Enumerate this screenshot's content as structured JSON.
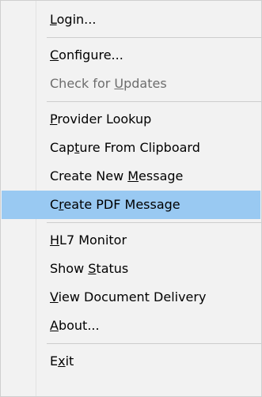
{
  "menu": {
    "groups": [
      {
        "items": [
          {
            "pre": "",
            "acc": "L",
            "post": "ogin...",
            "disabled": false,
            "highlighted": false
          }
        ]
      },
      {
        "items": [
          {
            "pre": "",
            "acc": "C",
            "post": "onfigure...",
            "disabled": false,
            "highlighted": false
          },
          {
            "pre": "Check for ",
            "acc": "U",
            "post": "pdates",
            "disabled": true,
            "highlighted": false
          }
        ]
      },
      {
        "items": [
          {
            "pre": "",
            "acc": "P",
            "post": "rovider Lookup",
            "disabled": false,
            "highlighted": false
          },
          {
            "pre": "Cap",
            "acc": "t",
            "post": "ure From Clipboard",
            "disabled": false,
            "highlighted": false
          },
          {
            "pre": "Create New ",
            "acc": "M",
            "post": "essage",
            "disabled": false,
            "highlighted": false
          },
          {
            "pre": "C",
            "acc": "r",
            "post": "eate PDF Message",
            "disabled": false,
            "highlighted": true
          }
        ]
      },
      {
        "items": [
          {
            "pre": "",
            "acc": "H",
            "post": "L7 Monitor",
            "disabled": false,
            "highlighted": false
          },
          {
            "pre": "Show ",
            "acc": "S",
            "post": "tatus",
            "disabled": false,
            "highlighted": false
          },
          {
            "pre": "",
            "acc": "V",
            "post": "iew Document Delivery",
            "disabled": false,
            "highlighted": false
          },
          {
            "pre": "",
            "acc": "A",
            "post": "bout...",
            "disabled": false,
            "highlighted": false
          }
        ]
      },
      {
        "items": [
          {
            "pre": "E",
            "acc": "x",
            "post": "it",
            "disabled": false,
            "highlighted": false
          }
        ]
      }
    ]
  }
}
